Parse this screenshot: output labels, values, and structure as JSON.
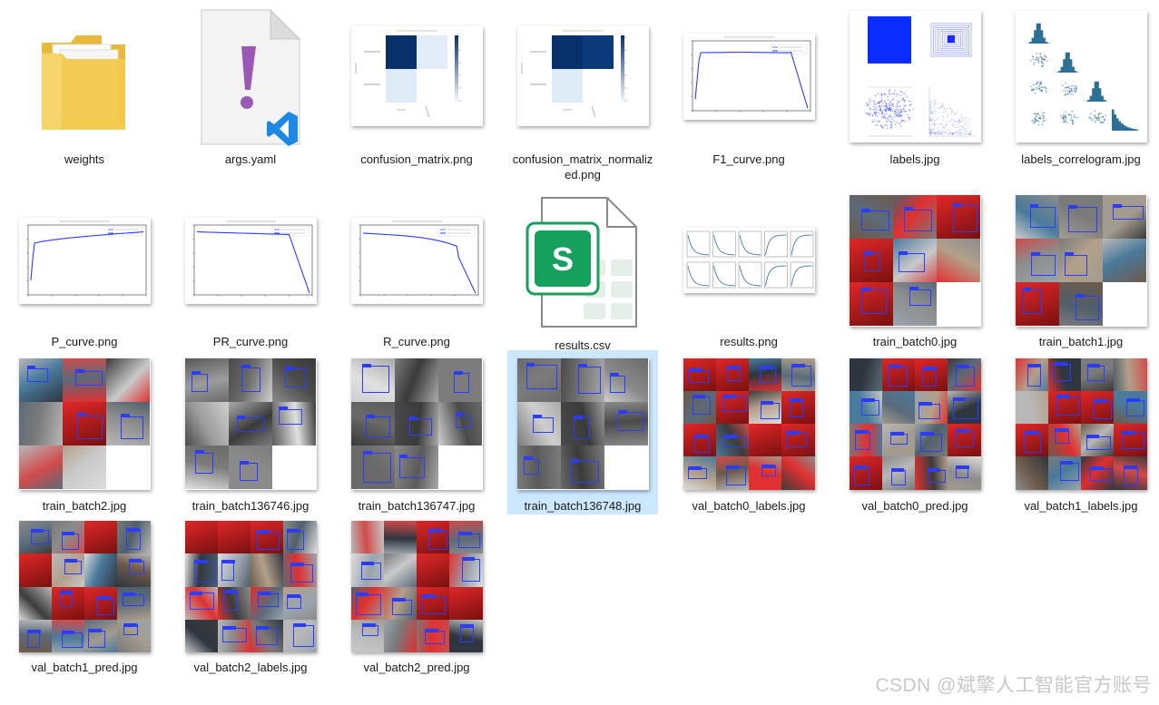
{
  "files": [
    {
      "name": "weights",
      "kind": "folder"
    },
    {
      "name": "args.yaml",
      "kind": "yaml"
    },
    {
      "name": "confusion_matrix.png",
      "kind": "confusion"
    },
    {
      "name": "confusion_matrix_normalized.png",
      "kind": "confusion_norm"
    },
    {
      "name": "F1_curve.png",
      "kind": "curve_f1"
    },
    {
      "name": "labels.jpg",
      "kind": "labels"
    },
    {
      "name": "labels_correlogram.jpg",
      "kind": "correlogram"
    },
    {
      "name": "P_curve.png",
      "kind": "curve_p"
    },
    {
      "name": "PR_curve.png",
      "kind": "curve_pr"
    },
    {
      "name": "R_curve.png",
      "kind": "curve_r"
    },
    {
      "name": "results.csv",
      "kind": "csv"
    },
    {
      "name": "results.png",
      "kind": "results"
    },
    {
      "name": "train_batch0.jpg",
      "kind": "batch3"
    },
    {
      "name": "train_batch1.jpg",
      "kind": "batch3"
    },
    {
      "name": "train_batch2.jpg",
      "kind": "batch3"
    },
    {
      "name": "train_batch136746.jpg",
      "kind": "batch3gray"
    },
    {
      "name": "train_batch136747.jpg",
      "kind": "batch3gray"
    },
    {
      "name": "train_batch136748.jpg",
      "kind": "batch3gray",
      "selected": true
    },
    {
      "name": "val_batch0_labels.jpg",
      "kind": "batch4"
    },
    {
      "name": "val_batch0_pred.jpg",
      "kind": "batch4"
    },
    {
      "name": "val_batch1_labels.jpg",
      "kind": "batch4"
    },
    {
      "name": "val_batch1_pred.jpg",
      "kind": "batch4"
    },
    {
      "name": "val_batch2_labels.jpg",
      "kind": "batch4"
    },
    {
      "name": "val_batch2_pred.jpg",
      "kind": "batch4"
    }
  ],
  "colors": {
    "selection": "#cce8ff",
    "folder": "#f2c94c",
    "yaml_mark": "#9b59b6",
    "vscode_blue": "#1e88e5",
    "sheets_green": "#16a05d",
    "cm_dark": "#08306b",
    "curve_blue": "#2a3cff",
    "bbox_blue": "#2a3cff"
  },
  "watermark": "CSDN @斌擎人工智能官方账号"
}
